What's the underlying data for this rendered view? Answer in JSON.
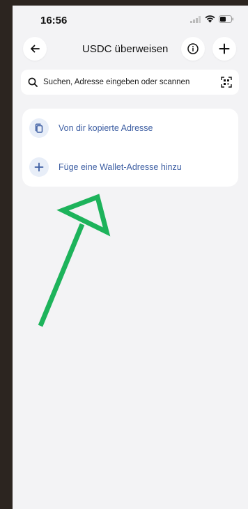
{
  "status_bar": {
    "time": "16:56"
  },
  "header": {
    "title": "USDC überweisen"
  },
  "search": {
    "placeholder": "Suchen, Adresse eingeben oder scannen"
  },
  "options": [
    {
      "label": "Von dir kopierte Adresse",
      "icon": "copy-icon"
    },
    {
      "label": "Füge eine Wallet-Adresse hinzu",
      "icon": "plus-icon"
    }
  ],
  "colors": {
    "accent": "#3e5fa3",
    "annotation_arrow": "#1db35b",
    "background": "#f3f3f5"
  }
}
